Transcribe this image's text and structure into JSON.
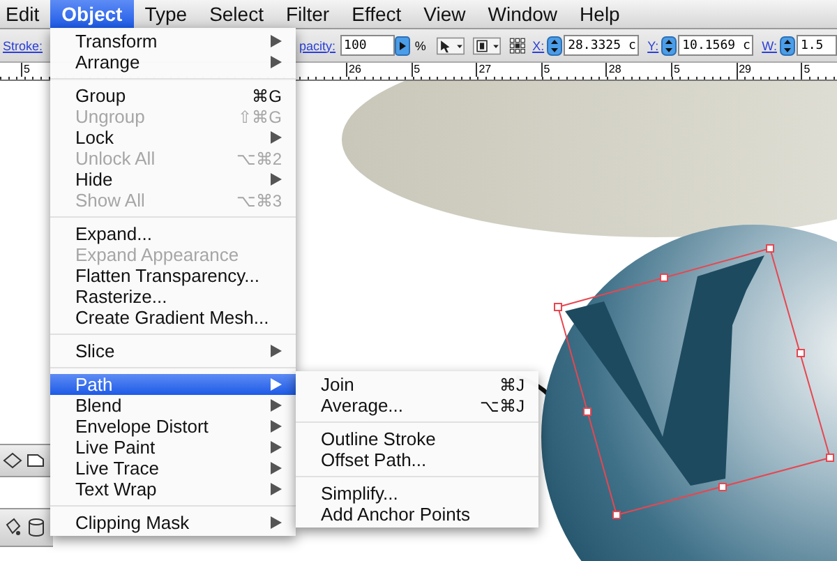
{
  "menubar": {
    "items": [
      {
        "label": "Edit",
        "selected": false
      },
      {
        "label": "Object",
        "selected": true
      },
      {
        "label": "Type",
        "selected": false
      },
      {
        "label": "Select",
        "selected": false
      },
      {
        "label": "Filter",
        "selected": false
      },
      {
        "label": "Effect",
        "selected": false
      },
      {
        "label": "View",
        "selected": false
      },
      {
        "label": "Window",
        "selected": false
      },
      {
        "label": "Help",
        "selected": false
      }
    ]
  },
  "control_bar": {
    "stroke_label": "Stroke:",
    "opacity_label": "pacity:",
    "opacity_value": "100",
    "opacity_unit": "%",
    "fields": [
      {
        "label": "X:",
        "value": "28.3325 c"
      },
      {
        "label": "Y:",
        "value": "10.1569 c"
      },
      {
        "label": "W:",
        "value": "1.5"
      }
    ]
  },
  "ruler": {
    "labels": [
      "5",
      "26",
      "5",
      "27",
      "5",
      "28",
      "5",
      "29",
      "5"
    ]
  },
  "object_menu": {
    "items": [
      {
        "kind": "item",
        "label": "Transform",
        "submenu": true,
        "disabled": false,
        "selected": false
      },
      {
        "kind": "item",
        "label": "Arrange",
        "submenu": true,
        "disabled": false,
        "selected": false
      },
      {
        "kind": "separator"
      },
      {
        "kind": "item",
        "label": "Group",
        "shortcut": "⌘G",
        "disabled": false,
        "selected": false
      },
      {
        "kind": "item",
        "label": "Ungroup",
        "shortcut": "⇧⌘G",
        "disabled": true,
        "selected": false
      },
      {
        "kind": "item",
        "label": "Lock",
        "submenu": true,
        "disabled": false,
        "selected": false
      },
      {
        "kind": "item",
        "label": "Unlock All",
        "shortcut": "⌥⌘2",
        "disabled": true,
        "selected": false
      },
      {
        "kind": "item",
        "label": "Hide",
        "submenu": true,
        "disabled": false,
        "selected": false
      },
      {
        "kind": "item",
        "label": "Show All",
        "shortcut": "⌥⌘3",
        "disabled": true,
        "selected": false
      },
      {
        "kind": "separator"
      },
      {
        "kind": "item",
        "label": "Expand...",
        "disabled": false,
        "selected": false
      },
      {
        "kind": "item",
        "label": "Expand Appearance",
        "disabled": true,
        "selected": false
      },
      {
        "kind": "item",
        "label": "Flatten Transparency...",
        "disabled": false,
        "selected": false
      },
      {
        "kind": "item",
        "label": "Rasterize...",
        "disabled": false,
        "selected": false
      },
      {
        "kind": "item",
        "label": "Create Gradient Mesh...",
        "disabled": false,
        "selected": false
      },
      {
        "kind": "separator"
      },
      {
        "kind": "item",
        "label": "Slice",
        "submenu": true,
        "disabled": false,
        "selected": false
      },
      {
        "kind": "separator"
      },
      {
        "kind": "item",
        "label": "Path",
        "submenu": true,
        "disabled": false,
        "selected": true
      },
      {
        "kind": "item",
        "label": "Blend",
        "submenu": true,
        "disabled": false,
        "selected": false
      },
      {
        "kind": "item",
        "label": "Envelope Distort",
        "submenu": true,
        "disabled": false,
        "selected": false
      },
      {
        "kind": "item",
        "label": "Live Paint",
        "submenu": true,
        "disabled": false,
        "selected": false
      },
      {
        "kind": "item",
        "label": "Live Trace",
        "submenu": true,
        "disabled": false,
        "selected": false
      },
      {
        "kind": "item",
        "label": "Text Wrap",
        "submenu": true,
        "disabled": false,
        "selected": false
      },
      {
        "kind": "separator"
      },
      {
        "kind": "item",
        "label": "Clipping Mask",
        "submenu": true,
        "disabled": false,
        "selected": false
      }
    ]
  },
  "path_submenu": {
    "items": [
      {
        "kind": "item",
        "label": "Join",
        "shortcut": "⌘J"
      },
      {
        "kind": "item",
        "label": "Average...",
        "shortcut": "⌥⌘J"
      },
      {
        "kind": "separator"
      },
      {
        "kind": "item",
        "label": "Outline Stroke"
      },
      {
        "kind": "item",
        "label": "Offset Path..."
      },
      {
        "kind": "separator"
      },
      {
        "kind": "item",
        "label": "Simplify..."
      },
      {
        "kind": "item",
        "label": "Add Anchor Points"
      }
    ]
  }
}
